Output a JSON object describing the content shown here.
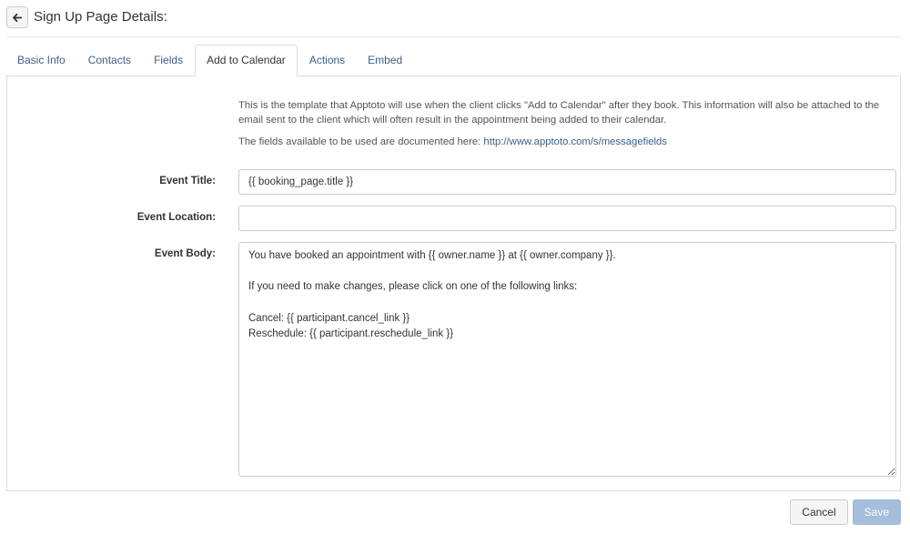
{
  "header": {
    "back_icon": "arrow-left-icon",
    "title": "Sign Up Page Details:"
  },
  "tabs": [
    {
      "label": "Basic Info",
      "active": false
    },
    {
      "label": "Contacts",
      "active": false
    },
    {
      "label": "Fields",
      "active": false
    },
    {
      "label": "Add to Calendar",
      "active": true
    },
    {
      "label": "Actions",
      "active": false
    },
    {
      "label": "Embed",
      "active": false
    }
  ],
  "help": {
    "paragraph1": "This is the template that Apptoto will use when the client clicks \"Add to Calendar\" after they book. This information will also be attached to the email sent to the client which will often result in the appointment being added to their calendar.",
    "paragraph2_prefix": "The fields available to be used are documented here: ",
    "link_text": "http://www.apptoto.com/s/messagefields"
  },
  "form": {
    "event_title": {
      "label": "Event Title:",
      "value": "{{ booking_page.title }}"
    },
    "event_location": {
      "label": "Event Location:",
      "value": ""
    },
    "event_body": {
      "label": "Event Body:",
      "value": "You have booked an appointment with {{ owner.name }} at {{ owner.company }}.\n\nIf you need to make changes, please click on one of the following links:\n\nCancel: {{ participant.cancel_link }}\nReschedule: {{ participant.reschedule_link }}"
    }
  },
  "footer": {
    "cancel_label": "Cancel",
    "save_label": "Save"
  },
  "colors": {
    "link": "#3b5f85",
    "save_button": "#a4bedb",
    "border": "#dddddd"
  }
}
